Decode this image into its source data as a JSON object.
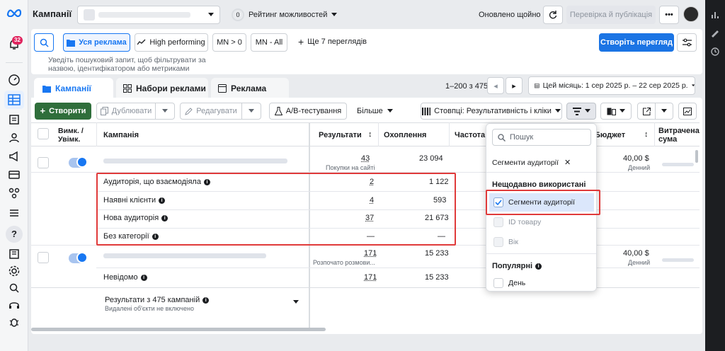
{
  "header": {
    "title": "Кампанії",
    "opportunity_score": "0",
    "opportunity_label": "Рейтинг можливостей",
    "updated": "Оновлено щойно",
    "review_publish": "Перевірка й публікація"
  },
  "sidebar": {
    "notification_count": "32"
  },
  "toolbar": {
    "search_placeholder": "Уведіть пошуковий запит, щоб фільтрувати за назвою, ідентифікатором або метриками",
    "views": [
      "Уся реклама",
      "High performing",
      "MN > 0",
      "MN - All"
    ],
    "more_views": "Ще 7 переглядів",
    "create_view": "Створіть перегляд"
  },
  "tabs": {
    "campaigns": "Кампанії",
    "adsets": "Набори реклами",
    "ads": "Реклама"
  },
  "pagination": {
    "range": "1–200 з 475"
  },
  "date_range": "Цей місяць: 1 сер 2025 р. – 22 сер 2025 р.",
  "actions": {
    "create": "Створити",
    "duplicate": "Дублювати",
    "edit": "Редагувати",
    "ab_test": "A/B-тестування",
    "more": "Більше",
    "columns": "Стовпці: Результативність і кліки"
  },
  "table": {
    "headers": {
      "toggle": "Вимк. / Увімк.",
      "campaign": "Кампанія",
      "results": "Результати",
      "reach": "Охоплення",
      "frequency": "Частота",
      "budget": "Бюджет",
      "spent": "Витрачена сума"
    },
    "campaign1": {
      "results": "43",
      "results_sub": "Покупки на сайті",
      "reach": "23 094",
      "budget": "40,00 $",
      "budget_sub": "Денний"
    },
    "breakdown": [
      {
        "label": "Аудиторія, що взаємодіяла",
        "results": "2",
        "reach": "1 122"
      },
      {
        "label": "Наявні клієнти",
        "results": "4",
        "reach": "593"
      },
      {
        "label": "Нова аудиторія",
        "results": "37",
        "reach": "21 673"
      },
      {
        "label": "Без категорії",
        "results": "—",
        "reach": "—"
      }
    ],
    "campaign2": {
      "results": "171",
      "results_sub": "Розпочато розмови...",
      "reach": "15 233",
      "budget": "40,00 $",
      "budget_sub": "Денний"
    },
    "unknown": {
      "label": "Невідомо",
      "results": "171",
      "reach": "15 233"
    },
    "footer": {
      "title": "Результати з 475 кампаній",
      "sub": "Видалені об'єкти не включено"
    }
  },
  "dropdown": {
    "search_placeholder": "Пошук",
    "selected_chip": "Сегменти аудиторії",
    "recent_title": "Нещодавно використані",
    "recent_items": [
      "Сегменти аудиторії",
      "ID товару",
      "Вік"
    ],
    "popular_title": "Популярні",
    "popular_items": [
      "День"
    ]
  },
  "colors": {
    "primary": "#1877f2",
    "create_green": "#2f6e3b",
    "highlight_red": "#e03a3a",
    "selected_bg": "#dbe7fb"
  }
}
